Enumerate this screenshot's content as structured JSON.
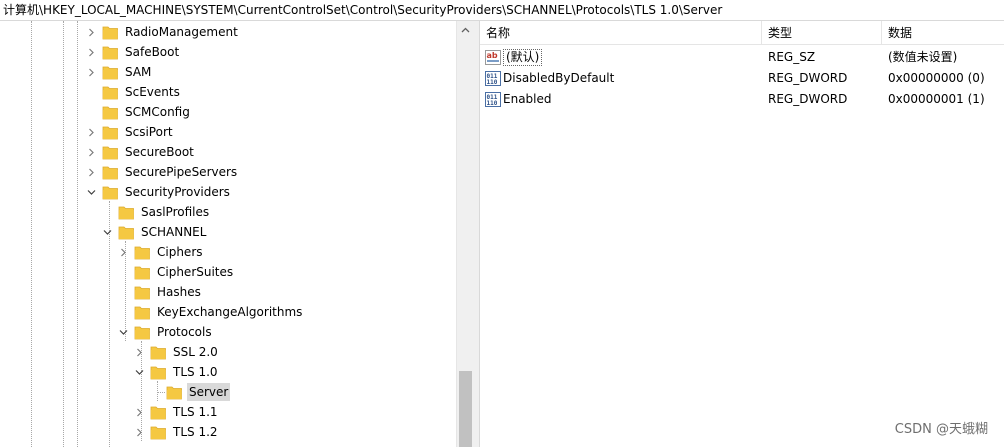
{
  "address_path": "计算机\\HKEY_LOCAL_MACHINE\\SYSTEM\\CurrentControlSet\\Control\\SecurityProviders\\SCHANNEL\\Protocols\\TLS 1.0\\Server",
  "tree": {
    "items": [
      {
        "label": "RadioManagement",
        "expander": "collapsed"
      },
      {
        "label": "SafeBoot",
        "expander": "collapsed"
      },
      {
        "label": "SAM",
        "expander": "collapsed"
      },
      {
        "label": "ScEvents",
        "expander": "none"
      },
      {
        "label": "SCMConfig",
        "expander": "none"
      },
      {
        "label": "ScsiPort",
        "expander": "collapsed"
      },
      {
        "label": "SecureBoot",
        "expander": "collapsed"
      },
      {
        "label": "SecurePipeServers",
        "expander": "collapsed"
      },
      {
        "label": "SecurityProviders",
        "expander": "expanded"
      },
      {
        "label": "SaslProfiles",
        "expander": "none"
      },
      {
        "label": "SCHANNEL",
        "expander": "expanded"
      },
      {
        "label": "Ciphers",
        "expander": "collapsed"
      },
      {
        "label": "CipherSuites",
        "expander": "none"
      },
      {
        "label": "Hashes",
        "expander": "none"
      },
      {
        "label": "KeyExchangeAlgorithms",
        "expander": "none"
      },
      {
        "label": "Protocols",
        "expander": "expanded"
      },
      {
        "label": "SSL 2.0",
        "expander": "collapsed"
      },
      {
        "label": "TLS 1.0",
        "expander": "expanded"
      },
      {
        "label": "Server",
        "expander": "none",
        "selected": true
      },
      {
        "label": "TLS 1.1",
        "expander": "collapsed"
      },
      {
        "label": "TLS 1.2",
        "expander": "collapsed"
      }
    ]
  },
  "values_header": {
    "name": "名称",
    "type": "类型",
    "data": "数据"
  },
  "values": [
    {
      "icon": "string-value-icon",
      "name": "(默认)",
      "type": "REG_SZ",
      "data": "(数值未设置)"
    },
    {
      "icon": "dword-value-icon",
      "name": "DisabledByDefault",
      "type": "REG_DWORD",
      "data": "0x00000000 (0)"
    },
    {
      "icon": "dword-value-icon",
      "name": "Enabled",
      "type": "REG_DWORD",
      "data": "0x00000001 (1)"
    }
  ],
  "watermark": "CSDN @天蛾糊",
  "colors": {
    "folder": "#f5c842",
    "folder_edge": "#dcaa2c",
    "selected_bg": "#d9d9d9",
    "scroll_thumb": "#c1c1c1"
  }
}
